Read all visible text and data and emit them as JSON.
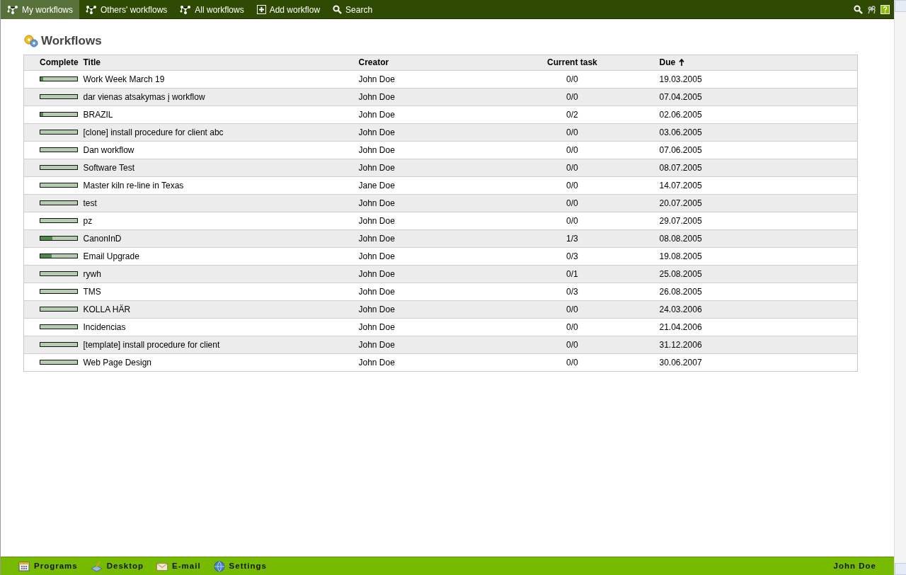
{
  "top_nav": [
    {
      "label": "My workflows",
      "selected": true
    },
    {
      "label": "Others' workflows",
      "selected": false
    },
    {
      "label": "All workflows",
      "selected": false
    },
    {
      "label": "Add workflow",
      "selected": false
    },
    {
      "label": "Search",
      "selected": false
    }
  ],
  "heading": "Workflows",
  "table": {
    "columns": [
      "Complete",
      "Title",
      "Creator",
      "Current task",
      "Due"
    ],
    "rows": [
      {
        "level": 0.08,
        "title": "Work Week March 19",
        "creator": "John Doe",
        "task": "0/0",
        "due": "19.03.2005"
      },
      {
        "level": 0,
        "title": "dar vienas atsakymas į workflow",
        "creator": "John Doe",
        "task": "0/0",
        "due": "07.04.2005"
      },
      {
        "level": 0.08,
        "title": "BRAZIL",
        "creator": "John Doe",
        "task": "0/2",
        "due": "02.06.2005"
      },
      {
        "level": 0,
        "title": "[clone] install procedure for client abc",
        "creator": "John Doe",
        "task": "0/0",
        "due": "03.06.2005"
      },
      {
        "level": 0,
        "title": "Dan workflow",
        "creator": "John Doe",
        "task": "0/0",
        "due": "07.06.2005"
      },
      {
        "level": 0,
        "title": "Software Test",
        "creator": "John Doe",
        "task": "0/0",
        "due": "08.07.2005"
      },
      {
        "level": 0,
        "title": "Master kiln re-line in Texas",
        "creator": "Jane Doe",
        "task": "0/0",
        "due": "14.07.2005"
      },
      {
        "level": 0,
        "title": "test",
        "creator": "John Doe",
        "task": "0/0",
        "due": "20.07.2005"
      },
      {
        "level": 0,
        "title": "pz",
        "creator": "John Doe",
        "task": "0/0",
        "due": "29.07.2005"
      },
      {
        "level": 0.33,
        "title": "CanonInD",
        "creator": "John Doe",
        "task": "1/3",
        "due": "08.08.2005"
      },
      {
        "level": 0.3,
        "title": "Email Upgrade",
        "creator": "John Doe",
        "task": "0/3",
        "due": "19.08.2005"
      },
      {
        "level": 0,
        "title": "rywh",
        "creator": "John Doe",
        "task": "0/1",
        "due": "25.08.2005"
      },
      {
        "level": 0,
        "title": "TMS",
        "creator": "John Doe",
        "task": "0/3",
        "due": "26.08.2005"
      },
      {
        "level": 0,
        "title": "KOLLA HÄR",
        "creator": "John Doe",
        "task": "0/0",
        "due": "24.03.2006"
      },
      {
        "level": 0,
        "title": "Incidencias",
        "creator": "John Doe",
        "task": "0/0",
        "due": "21.04.2006"
      },
      {
        "level": 0,
        "title": "[template] install procedure for client",
        "creator": "John Doe",
        "task": "0/0",
        "due": "31.12.2006"
      },
      {
        "level": 0,
        "title": "Web Page Design",
        "creator": "John Doe",
        "task": "0/0",
        "due": "30.06.2007"
      }
    ]
  },
  "taskbar": {
    "items": [
      {
        "label": "Programs"
      },
      {
        "label": "Desktop"
      },
      {
        "label": "E-mail"
      },
      {
        "label": "Settings"
      }
    ],
    "user": "John Doe"
  }
}
